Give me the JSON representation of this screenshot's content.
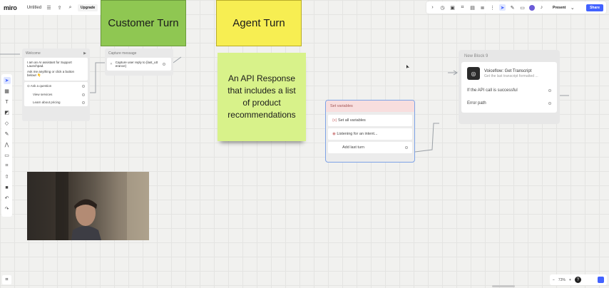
{
  "app": {
    "logo": "miro",
    "board_title": "Untitled",
    "upgrade_label": "Upgrade"
  },
  "toolbar_right": {
    "present_label": "Present",
    "share_label": "Share"
  },
  "stickies": {
    "customer": "Customer Turn",
    "agent": "Agent Turn",
    "api": "An API Response that includes a list of product recommendations"
  },
  "welcome_block": {
    "title": "Welcome",
    "message_line1": "I am an AI assistant for Support",
    "message_line2": "Launchpad.",
    "message_line3": "Ask me anything or click a button",
    "message_line4": "below! 👇",
    "buttons": [
      "Ask a question",
      "View services",
      "Learn about pricing"
    ]
  },
  "capture_block": {
    "title": "Capture message",
    "text": "Capture user reply to {last_utt erance}"
  },
  "setvars_block": {
    "title": "Set variables",
    "rows": [
      "Set all variables",
      "Listening for an intent...",
      "Add last turn"
    ]
  },
  "new_block": {
    "title": "New Block 9",
    "vf_title": "Voiceflow: Get Transcript",
    "vf_sub": "Get the last transcript formatted ...",
    "rows": [
      "If the API call is successful",
      "Error path"
    ]
  },
  "zoom": {
    "level": "73%"
  },
  "icons": {
    "menu": "menu-icon",
    "export": "export-icon",
    "search": "search-icon",
    "timer": "timer-icon",
    "frames": "frames-icon",
    "play": "play-icon"
  }
}
